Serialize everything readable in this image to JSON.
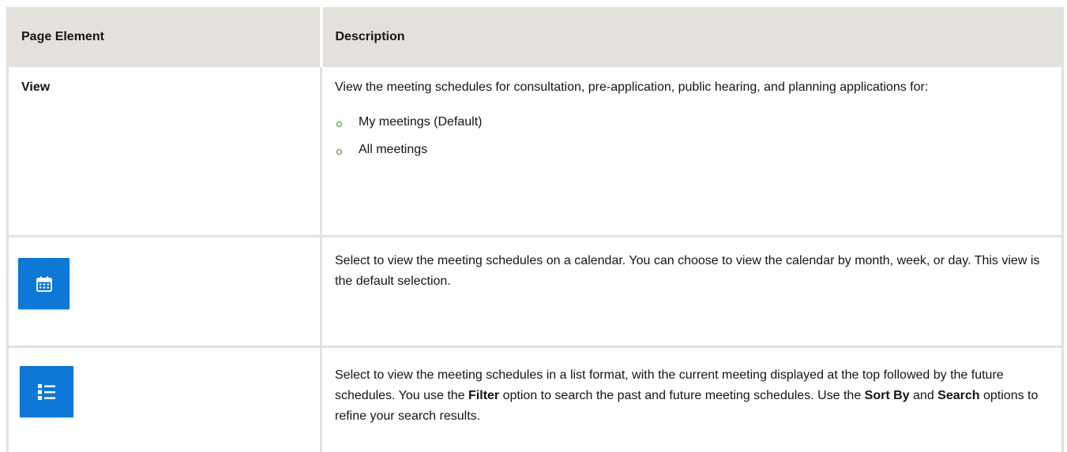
{
  "table": {
    "headers": {
      "col1": "Page Element",
      "col2": "Description"
    },
    "rows": {
      "view": {
        "term": "View",
        "intro": "View the meeting schedules for consultation, pre-application, public hearing, and planning applications for:",
        "options": [
          "My meetings (Default)",
          "All meetings"
        ]
      },
      "calendar": {
        "icon": "calendar-icon",
        "description": "Select to view the meeting schedules on a calendar. You can choose to view the calendar by month, week, or day. This view is the default selection."
      },
      "list": {
        "icon": "list-icon",
        "desc_part1": "Select to view the meeting schedules in a list format, with the current meeting displayed at the top followed by the future schedules. You use the ",
        "filter": "Filter",
        "desc_part2": " option to search the past and future meeting schedules. Use the ",
        "sort_by": "Sort By",
        "desc_part3": " and ",
        "search": "Search",
        "desc_part4": " options to refine your search results."
      }
    }
  },
  "colors": {
    "header_bg": "#e4e1dd",
    "icon_bg": "#0d78d6",
    "bullet": "#3f8428"
  }
}
